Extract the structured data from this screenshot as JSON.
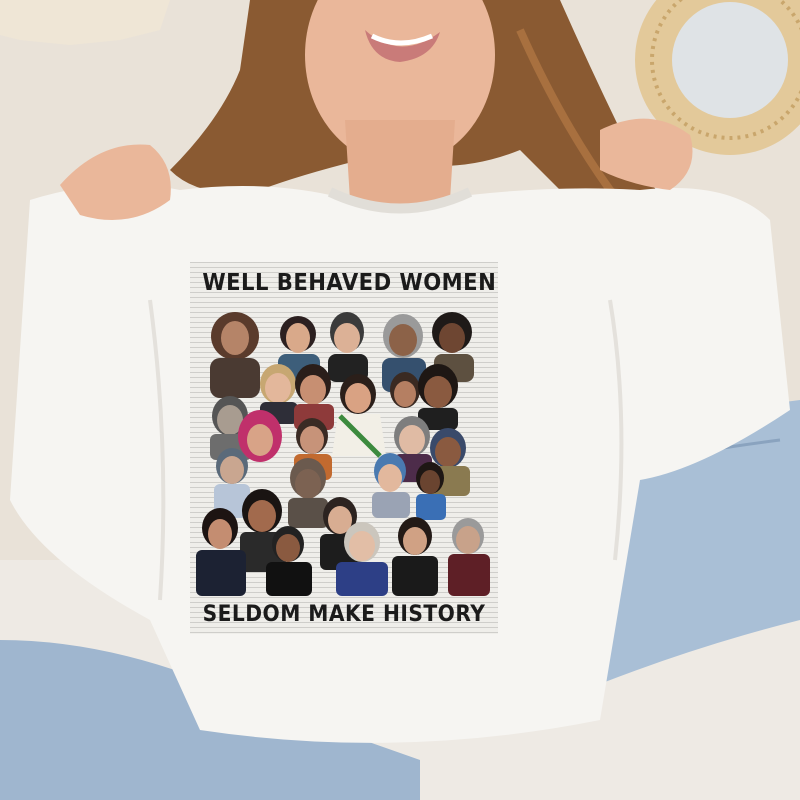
{
  "shirt": {
    "headline_top": "WELL BEHAVED WOMEN",
    "headline_bottom": "SELDOM MAKE HISTORY"
  },
  "colors": {
    "background_wall": "#e9e2d8",
    "sweatshirt": "#f6f5f2",
    "jeans": "#a9bfd6",
    "hair": "#8a5a32",
    "skin": "#eab79a",
    "print_text": "#1b1b1b"
  }
}
